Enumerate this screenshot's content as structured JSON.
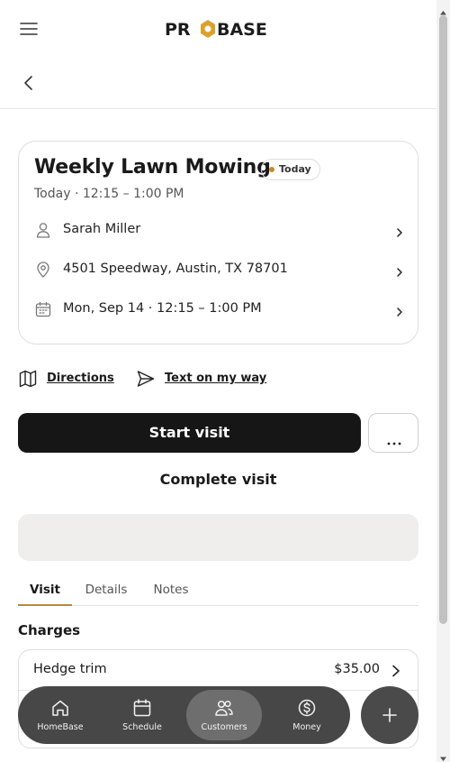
{
  "header": {
    "menu_icon": "hamburger-menu-icon",
    "logo_text": "PROBASE",
    "back_icon": "chevron-left-icon"
  },
  "job": {
    "title": "Weekly Lawn Mowing",
    "badge": "Today",
    "time": "Today · 12:15 – 1:00 PM",
    "rows": [
      {
        "icon": "person-icon",
        "text": "Sarah Miller"
      },
      {
        "icon": "location-pin-icon",
        "text": "4501 Speedway, Austin, TX 78701"
      },
      {
        "icon": "calendar-icon",
        "text": "Mon, Sep 14 · 12:15 – 1:00 PM"
      }
    ]
  },
  "links": {
    "directions": "Directions",
    "text_on_my_way": "Text on my way"
  },
  "actions": {
    "start_visit": "Start visit",
    "more": "more-options-icon",
    "complete_visit": "Complete visit"
  },
  "tabs": [
    {
      "label": "Visit",
      "active": true
    },
    {
      "label": "Details",
      "active": false
    },
    {
      "label": "Notes",
      "active": false
    }
  ],
  "charges": {
    "title": "Charges",
    "items": [
      {
        "name": "Hedge trim",
        "amount": "$35.00"
      },
      {
        "name": "",
        "amount": ""
      }
    ]
  },
  "nav": {
    "items": [
      {
        "label": "HomeBase",
        "icon": "home-icon",
        "active": false
      },
      {
        "label": "Schedule",
        "icon": "calendar-icon",
        "active": false
      },
      {
        "label": "Customers",
        "icon": "users-icon",
        "active": true
      },
      {
        "label": "Money",
        "icon": "dollar-circle-icon",
        "active": false
      }
    ],
    "fab_icon": "plus-icon"
  },
  "colors": {
    "primary_button": "#161616",
    "tab_underline": "#b58a3c",
    "badge_dot": "#c28a2a",
    "nav_background": "#474747",
    "nav_active": "#6e6e6e",
    "placeholder_block": "#efeeec"
  }
}
